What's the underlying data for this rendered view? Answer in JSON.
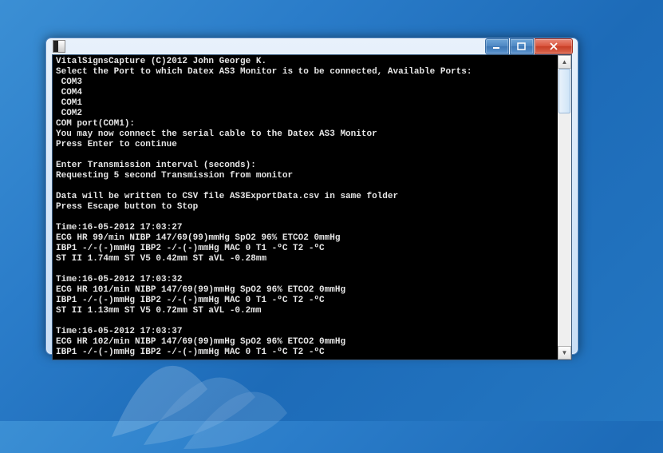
{
  "window": {
    "title": ""
  },
  "terminal": {
    "header": "VitalSignsCapture (C)2012 John George K.",
    "select_prompt": "Select the Port to which Datex AS3 Monitor is to be connected, Available Ports:",
    "ports": [
      "COM3",
      "COM4",
      "COM1",
      "COM2"
    ],
    "com_port_line": "COM port(COM1):",
    "connect_msg": "You may now connect the serial cable to the Datex AS3 Monitor",
    "press_enter": "Press Enter to continue",
    "interval_prompt": "Enter Transmission interval (seconds):",
    "requesting": "Requesting 5 second Transmission from monitor",
    "csv_msg": "Data will be written to CSV file AS3ExportData.csv in same folder",
    "escape_msg": "Press Escape button to Stop",
    "records": [
      {
        "time": "Time:16-05-2012 17:03:27",
        "ecg": "ECG HR 99/min NIBP 147/69(99)mmHg SpO2 96% ETCO2 0mmHg",
        "ibp": "IBP1 -/-(-)mmHg IBP2 -/-(-)mmHg MAC 0 T1 -ºC T2 -ºC",
        "st": "ST II 1.74mm ST V5 0.42mm ST aVL -0.28mm"
      },
      {
        "time": "Time:16-05-2012 17:03:32",
        "ecg": "ECG HR 101/min NIBP 147/69(99)mmHg SpO2 96% ETCO2 0mmHg",
        "ibp": "IBP1 -/-(-)mmHg IBP2 -/-(-)mmHg MAC 0 T1 -ºC T2 -ºC",
        "st": "ST II 1.13mm ST V5 0.72mm ST aVL -0.2mm"
      },
      {
        "time": "Time:16-05-2012 17:03:37",
        "ecg": "ECG HR 102/min NIBP 147/69(99)mmHg SpO2 96% ETCO2 0mmHg",
        "ibp": "IBP1 -/-(-)mmHg IBP2 -/-(-)mmHg MAC 0 T1 -ºC T2 -ºC",
        "st": ""
      }
    ]
  }
}
